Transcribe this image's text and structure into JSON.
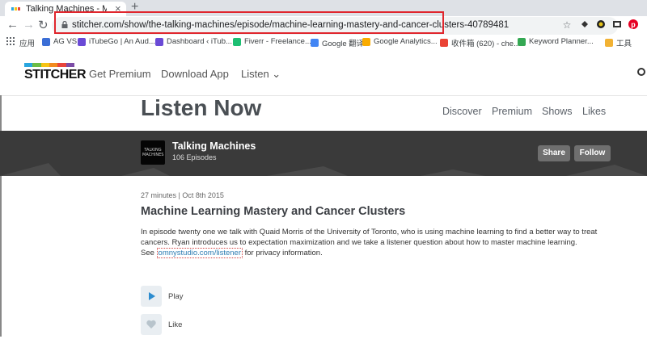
{
  "browser": {
    "tab_title": "Talking Machines - Machine L",
    "tab_close": "×",
    "new_tab": "+",
    "back": "←",
    "forward": "→",
    "reload": "↻",
    "url": "stitcher.com/show/the-talking-machines/episode/machine-learning-mastery-and-cancer-clusters-40789481",
    "bookmarks": [
      {
        "label": "应用",
        "color": "#e8453c"
      },
      {
        "label": "AG VS",
        "color": "#3b6ed6"
      },
      {
        "label": "iTubeGo | An Aud...",
        "color": "#6a4ad6"
      },
      {
        "label": "Dashboard ‹ iTub...",
        "color": "#6a4ad6"
      },
      {
        "label": "Fiverr - Freelance...",
        "color": "#1dbf73"
      },
      {
        "label": "Google 翻译",
        "color": "#4285f4"
      },
      {
        "label": "Google Analytics...",
        "color": "#f9ab00"
      },
      {
        "label": "收件箱 (620) - che...",
        "color": "#ea4335"
      },
      {
        "label": "Keyword Planner...",
        "color": "#34a853"
      },
      {
        "label": "工具",
        "color": "#f2b233"
      }
    ]
  },
  "site": {
    "logo_text": "STITCHER",
    "logo_colors": [
      "#29a6df",
      "#6cbd45",
      "#f6c415",
      "#f28b1e",
      "#e8453c",
      "#7c4ca6"
    ],
    "nav": {
      "premium": "Get Premium",
      "download": "Download App",
      "listen": "Listen ⌄"
    },
    "page_title": "Listen Now",
    "sub_nav": [
      "Discover",
      "Premium",
      "Shows",
      "Likes"
    ]
  },
  "show": {
    "art_text": "TALKING MACHINES",
    "name": "Talking Machines",
    "episodes": "106 Episodes",
    "share_label": "Share",
    "follow_label": "Follow"
  },
  "episode": {
    "meta": "27 minutes | Oct 8th 2015",
    "title": "Machine Learning Mastery and Cancer Clusters",
    "desc_line1": "In episode twenty one  we talk with Quaid Morris of the University of Toronto, who is using machine learning to find a better way to treat",
    "desc_line2": "cancers. Ryan introduces us to expectation maximization and we take a listener question about how to master machine learning.",
    "see_prefix": "See",
    "link": "omnystudio.com/listener",
    "see_suffix": "for privacy information.",
    "play_label": "Play",
    "like_label": "Like"
  }
}
